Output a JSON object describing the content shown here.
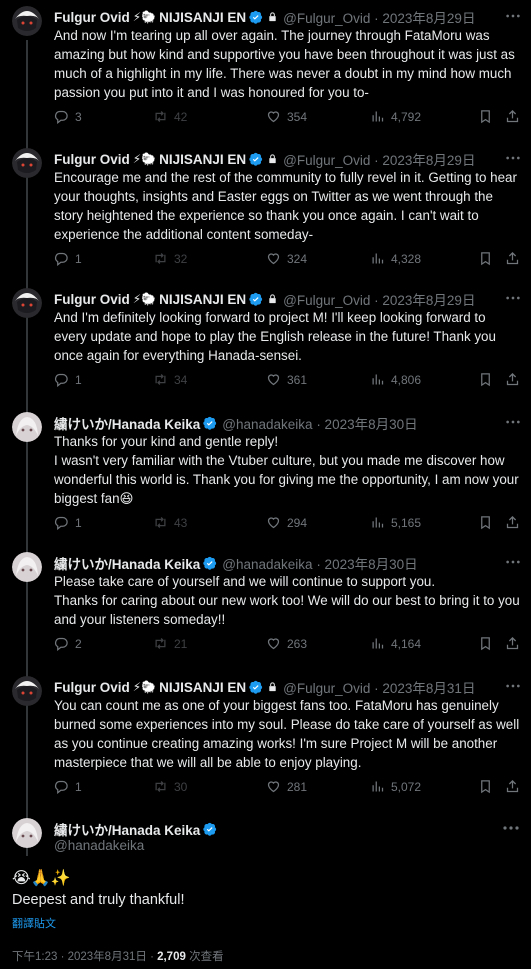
{
  "colors": {
    "accent": "#1d9bf0",
    "muted": "#71767b",
    "text": "#e7e9ea",
    "bg": "#000000"
  },
  "fulgur": {
    "name": "Fulgur Ovid",
    "emoji": "⚡🐑",
    "org": "NIJISANJI EN",
    "handle": "@Fulgur_Ovid"
  },
  "keika": {
    "name": "繍けいか/Hanada Keika",
    "handle": "@hanadakeika"
  },
  "replies": [
    {
      "author": "fulgur",
      "date": "2023年8月29日",
      "text": "And now I'm tearing up all over again. The journey through FataMoru was amazing but how kind and supportive you have been throughout it was just as much of a highlight in my life. There was never a doubt in my mind how much passion you put into it and I was honoured for you to-",
      "reply": "3",
      "retweet": "42",
      "like": "354",
      "views": "4,792"
    },
    {
      "author": "fulgur",
      "date": "2023年8月29日",
      "text": "Encourage me and the rest of the community to fully revel in it. Getting to hear your thoughts, insights and Easter eggs on Twitter as we went through the story heightened the experience so thank you once again. I can't wait to experience the additional content someday-",
      "reply": "1",
      "retweet": "32",
      "like": "324",
      "views": "4,328"
    },
    {
      "author": "fulgur",
      "date": "2023年8月29日",
      "text": "And I'm definitely looking forward to project M! I'll keep looking forward to every update and hope to play the English release in the future! Thank you once again for everything Hanada-sensei.",
      "reply": "1",
      "retweet": "34",
      "like": "361",
      "views": "4,806"
    },
    {
      "author": "keika",
      "date": "2023年8月30日",
      "text": "Thanks for your kind and gentle reply!\nI wasn't very familiar with the Vtuber culture, but you made me discover how wonderful this world is. Thank you for giving me the opportunity, I am now your biggest fan😆",
      "reply": "1",
      "retweet": "43",
      "like": "294",
      "views": "5,165"
    },
    {
      "author": "keika",
      "date": "2023年8月30日",
      "text": "Please take care of yourself and we will continue to support you.\nThanks for caring about our new work too! We will do our best to bring it to you and your listeners someday!!",
      "reply": "2",
      "retweet": "21",
      "like": "263",
      "views": "4,164"
    },
    {
      "author": "fulgur",
      "date": "2023年8月31日",
      "text": "You can count me as one of your biggest fans too. FataMoru has genuinely burned some experiences into my soul. Please do take care of yourself as well as you continue creating amazing works! I'm sure Project M will be another masterpiece that we will all be able to enjoy playing.",
      "reply": "1",
      "retweet": "30",
      "like": "281",
      "views": "5,072"
    }
  ],
  "main": {
    "emojis": "😭🙏✨",
    "text": "Deepest and truly thankful!",
    "translate": "翻譯貼文",
    "time": "下午1:23 · 2023年8月31日 · ",
    "views_count": "2,709",
    "views_label": " 次查看"
  }
}
